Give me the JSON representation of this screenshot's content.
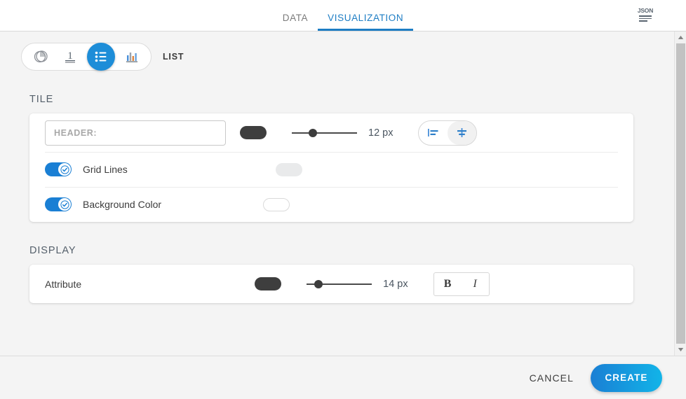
{
  "tabs": [
    {
      "label": "DATA",
      "active": false
    },
    {
      "label": "VISUALIZATION",
      "active": true
    }
  ],
  "json_button": {
    "label": "JSON",
    "icon": "json-icon"
  },
  "viz_types": {
    "options": [
      {
        "id": "pie",
        "icon": "pie-chart-icon",
        "selected": false
      },
      {
        "id": "number",
        "icon": "number-one-icon",
        "label": "1",
        "selected": false
      },
      {
        "id": "list",
        "icon": "list-icon",
        "selected": true
      },
      {
        "id": "bar",
        "icon": "bar-chart-icon",
        "selected": false
      }
    ],
    "current_label": "LIST"
  },
  "tile": {
    "section_title": "TILE",
    "header": {
      "label": "HEADER:",
      "placeholder": "HEADER:",
      "value": "",
      "color": "#3e3e3e",
      "font_size": "12 px",
      "slider_percent": 32,
      "align": {
        "options": [
          {
            "id": "left",
            "icon": "align-left-icon",
            "selected": false
          },
          {
            "id": "center",
            "icon": "align-center-icon",
            "selected": true
          }
        ]
      }
    },
    "grid_lines": {
      "label": "Grid Lines",
      "enabled": true,
      "color": "#e9eaeb"
    },
    "background_color": {
      "label": "Background Color",
      "enabled": true,
      "color": "#ffffff"
    }
  },
  "display": {
    "section_title": "DISPLAY",
    "attribute": {
      "label": "Attribute",
      "color": "#3e3e3e",
      "font_size": "14 px",
      "slider_percent": 18,
      "styles": [
        {
          "id": "bold",
          "label": "B",
          "selected": false
        },
        {
          "id": "italic",
          "label": "I",
          "selected": false
        }
      ]
    }
  },
  "footer": {
    "cancel_label": "CANCEL",
    "create_label": "CREATE"
  },
  "theme": {
    "accent": "#1d8dd8",
    "accent_dark": "#1a7fd4",
    "accent_light": "#12b4e8",
    "text": "#3c3c3c"
  }
}
